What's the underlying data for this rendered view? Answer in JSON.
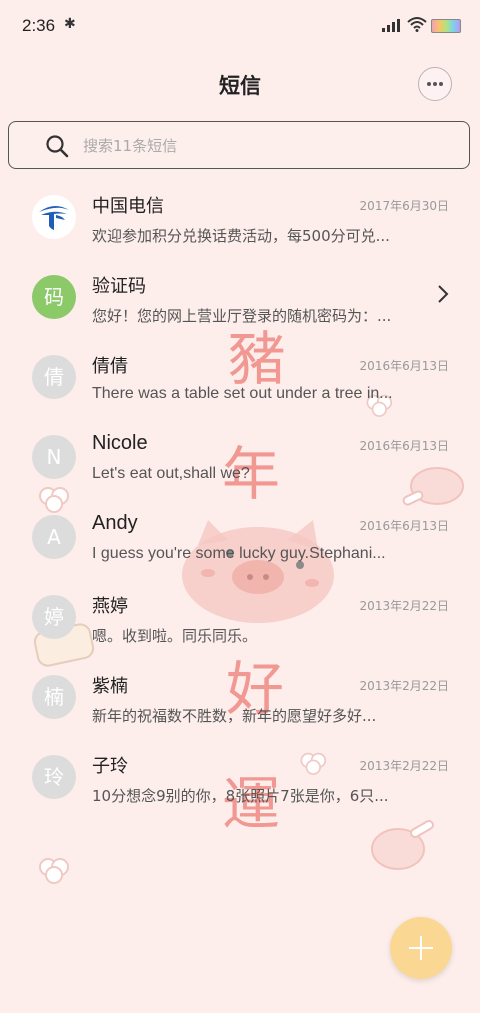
{
  "status_bar": {
    "time": "2:36",
    "icons": [
      "bluetooth-icon",
      "signal-icon",
      "wifi-icon",
      "battery-icon"
    ]
  },
  "header": {
    "title": "短信",
    "more_icon": "more-horizontal-icon"
  },
  "search": {
    "placeholder": "搜索11条短信",
    "value": ""
  },
  "background_text": [
    "豬",
    "年",
    "好",
    "運"
  ],
  "conversations": [
    {
      "name": "中国电信",
      "date": "2017年6月30日",
      "preview": "欢迎参加积分兑换话费活动，每500分可兑...",
      "avatar": "telecom-logo",
      "avatar_text": ""
    },
    {
      "name": "验证码",
      "date": "",
      "preview": "您好！您的网上营业厅登录的随机密码为：...",
      "avatar": "text",
      "avatar_text": "码"
    },
    {
      "name": "倩倩",
      "date": "2016年6月13日",
      "preview": "There was a table set out under a tree in...",
      "avatar": "text",
      "avatar_text": "倩"
    },
    {
      "name": "Nicole",
      "date": "2016年6月13日",
      "preview": "Let's eat out,shall we?",
      "avatar": "text",
      "avatar_text": "N"
    },
    {
      "name": "Andy",
      "date": "2016年6月13日",
      "preview": "I guess you're some lucky guy.Stephani...",
      "avatar": "text",
      "avatar_text": "A"
    },
    {
      "name": "燕婷",
      "date": "2013年2月22日",
      "preview": "嗯。收到啦。同乐同乐。",
      "avatar": "text",
      "avatar_text": "婷"
    },
    {
      "name": "紫楠",
      "date": "2013年2月22日",
      "preview": "新年的祝福数不胜数，新年的愿望好多好...",
      "avatar": "text",
      "avatar_text": "楠"
    },
    {
      "name": "子玲",
      "date": "2013年2月22日",
      "preview": "10分想念9别的你，8张照片7张是你，6只...",
      "avatar": "text",
      "avatar_text": "玲"
    }
  ],
  "fab": {
    "icon": "plus-icon"
  },
  "colors": {
    "background": "#fdeeec",
    "accent_fab": "#fad893",
    "avatar_green": "#8bc969",
    "decor_red": "#f08f89"
  }
}
